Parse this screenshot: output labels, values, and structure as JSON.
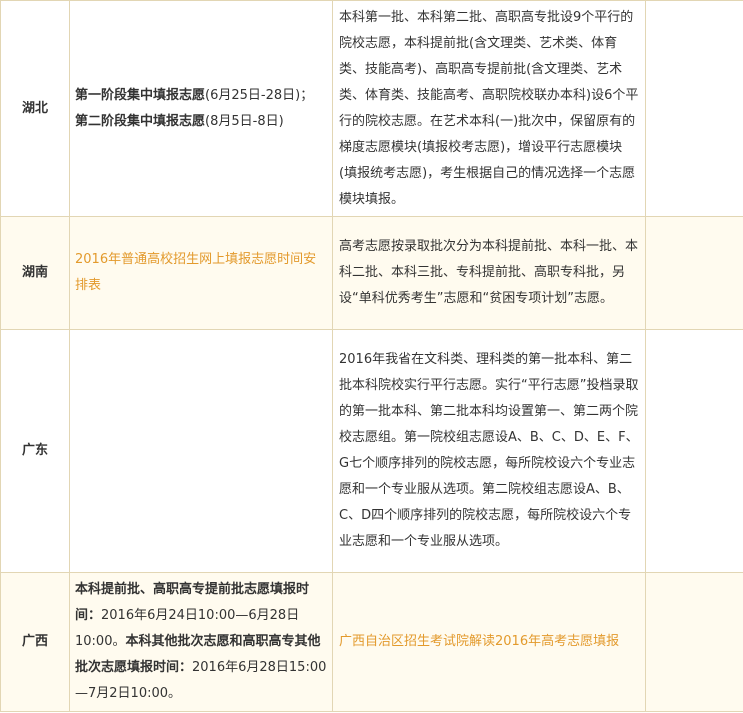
{
  "rows": [
    {
      "province": "湖北",
      "schedule_bold_1": "第一阶段集中填报志愿",
      "schedule_plain_1": "(6月25日-28日)；",
      "schedule_bold_2": "第二阶段集中填报志愿",
      "schedule_plain_2": "(8月5日-8日)",
      "description": "本科第一批、本科第二批、高职高专批设9个平行的院校志愿，本科提前批(含文理类、艺术类、体育类、技能高考)、高职高专提前批(含文理类、艺术类、体育类、技能高考、高职院校联办本科)设6个平行的院校志愿。在艺术本科(一)批次中，保留原有的梯度志愿模块(填报校考志愿)，增设平行志愿模块(填报统考志愿)，考生根据自己的情况选择一个志愿模块填报。"
    },
    {
      "province": "湖南",
      "link": "2016年普通高校招生网上填报志愿时间安排表",
      "description": "高考志愿按录取批次分为本科提前批、本科一批、本科二批、本科三批、专科提前批、高职专科批，另设“单科优秀考生”志愿和“贫困专项计划”志愿。"
    },
    {
      "province": "广东",
      "description": "2016年我省在文科类、理科类的第一批本科、第二批本科院校实行平行志愿。实行“平行志愿”投档录取的第一批本科、第二批本科均设置第一、第二两个院校志愿组。第一院校组志愿设A、B、C、D、E、F、G七个顺序排列的院校志愿，每所院校设六个专业志愿和一个专业服从选项。第二院校组志愿设A、B、C、D四个顺序排列的院校志愿，每所院校设六个专业志愿和一个专业服从选项。"
    },
    {
      "province": "广西",
      "schedule_bold_1": "本科提前批、高职高专提前批志愿填报时间：",
      "schedule_plain_1": "2016年6月24日10:00—6月28日10:00。",
      "schedule_bold_2": "本科其他批次志愿和高职高专其他批次志愿填报时间：",
      "schedule_plain_2": "2016年6月28日15:00—7月2日10:00。",
      "link": "广西自治区招生考试院解读2016年高考志愿填报"
    }
  ],
  "colors": {
    "link": "#e39a2c",
    "border": "#e2d6b4",
    "alt_row_bg": "#fffbef"
  }
}
